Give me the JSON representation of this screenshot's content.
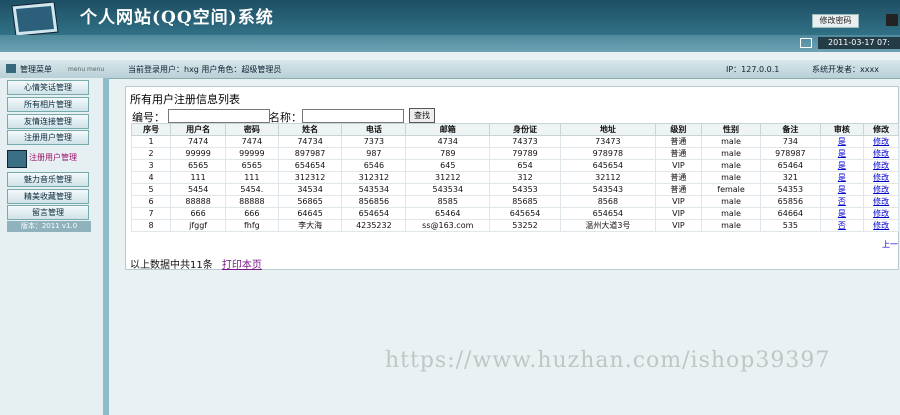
{
  "app": {
    "title": "个人网站(QQ空间)系统",
    "change_password": "修改密码",
    "datetime": "2011-03-17 07:"
  },
  "infobar": {
    "menu_label": "管理菜单",
    "menu_sub": "menu menu",
    "current_user": "当前登录用户：hxg  用户角色：超级管理员",
    "ip": "IP：127.0.0.1",
    "developer": "系统开发者：xxxx"
  },
  "sidebar": {
    "items": [
      "心情笑话管理",
      "所有相片管理",
      "友情连接管理",
      "注册用户管理",
      "注册用户管理",
      "魅力音乐管理",
      "精美收藏管理",
      "留言管理"
    ],
    "version": "版本：2011 v1.0"
  },
  "main": {
    "title": "所有用户注册信息列表",
    "filter": {
      "id_label": "编号：",
      "name_label": "名称：",
      "search_label": "查找"
    },
    "columns": [
      "序号",
      "用户名",
      "密码",
      "姓名",
      "电话",
      "邮箱",
      "身份证",
      "地址",
      "级别",
      "性别",
      "备注",
      "审核",
      "修改"
    ],
    "rows": [
      [
        "1",
        "7474",
        "7474",
        "74734",
        "7373",
        "4734",
        "74373",
        "73473",
        "普通",
        "male",
        "734",
        "是",
        "修改"
      ],
      [
        "2",
        "99999",
        "99999",
        "897987",
        "987",
        "789",
        "79789",
        "978978",
        "普通",
        "male",
        "978987",
        "是",
        "修改"
      ],
      [
        "3",
        "6565",
        "6565",
        "654654",
        "6546",
        "645",
        "654",
        "645654",
        "VIP",
        "male",
        "65464",
        "是",
        "修改"
      ],
      [
        "4",
        "111",
        "111",
        "312312",
        "312312",
        "31212",
        "312",
        "32112",
        "普通",
        "male",
        "321",
        "是",
        "修改"
      ],
      [
        "5",
        "5454",
        "5454.",
        "34534",
        "543534",
        "543534",
        "54353",
        "543543",
        "普通",
        "female",
        "54353",
        "是",
        "修改"
      ],
      [
        "6",
        "88888",
        "88888",
        "56865",
        "856856",
        "8585",
        "85685",
        "8568",
        "VIP",
        "male",
        "65856",
        "否",
        "修改"
      ],
      [
        "7",
        "666",
        "666",
        "64645",
        "654654",
        "65464",
        "645654",
        "654654",
        "VIP",
        "male",
        "64664",
        "是",
        "修改"
      ],
      [
        "8",
        "jfggf",
        "fhfg",
        "李大海",
        "4235232",
        "ss@163.com",
        "53252",
        "温州大道3号",
        "VIP",
        "male",
        "535",
        "否",
        "修改"
      ]
    ],
    "prev": "上一",
    "footer": "以上数据中共11条",
    "print": "打印本页"
  },
  "watermark": "https://www.huzhan.com/ishop39397"
}
